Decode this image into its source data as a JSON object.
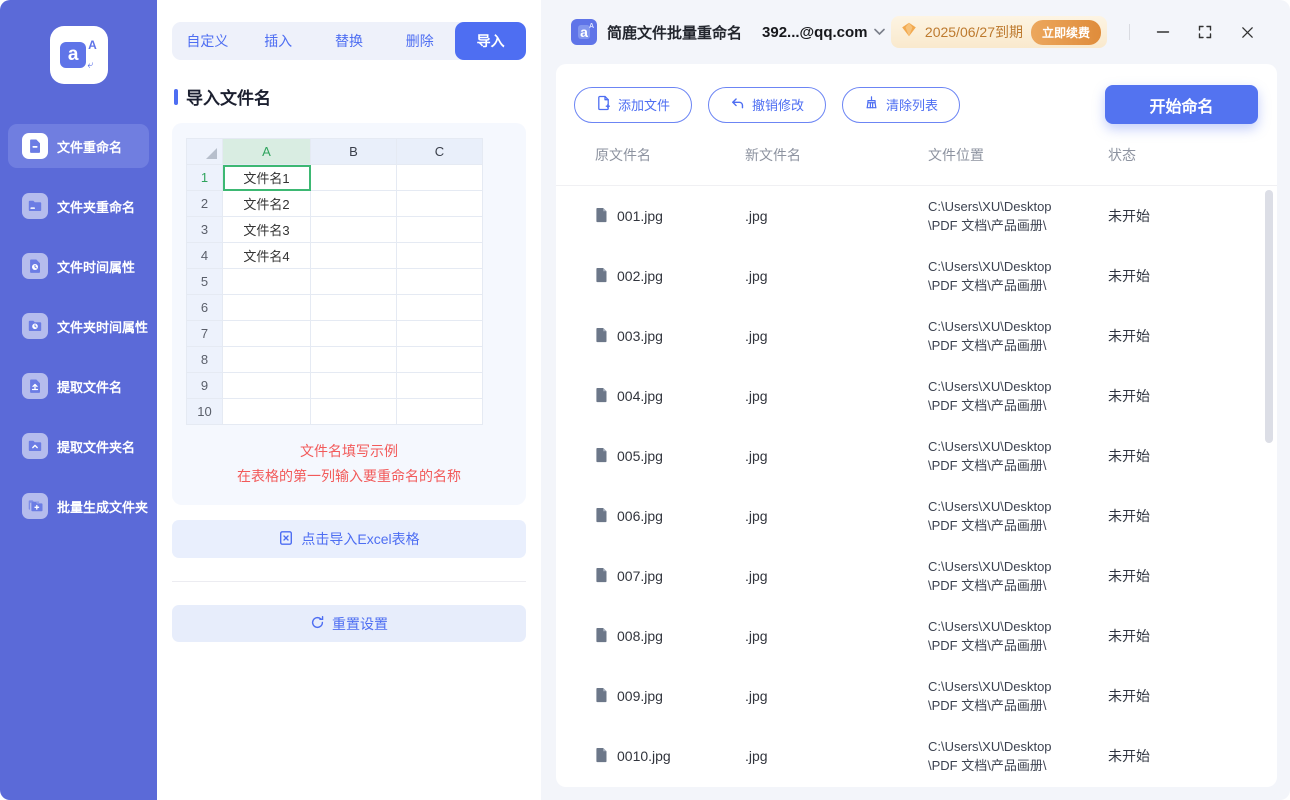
{
  "colors": {
    "sidebar_bg": "#5b6ad8",
    "sidebar_active_bg": "#707ee0",
    "primary_blue": "#4e6ef2",
    "start_button_blue": "#5373f0",
    "panel_bg": "#f3f5fa",
    "hint_red": "#f25a5a",
    "sheet_green": "#2fa45d",
    "selected_cell_border": "#3db873",
    "vip_bg": "#f9e9cd",
    "vip_text": "#bd7a2f",
    "renew_orange": "#df8c3b"
  },
  "sidebar": {
    "logo": {
      "letter_main": "a",
      "letter_small": "A"
    },
    "items": [
      {
        "key": "file-rename",
        "label": "文件重命名",
        "icon": "file-icon",
        "active": true
      },
      {
        "key": "folder-rename",
        "label": "文件夹重命名",
        "icon": "folder-icon",
        "active": false
      },
      {
        "key": "file-time",
        "label": "文件时间属性",
        "icon": "file-clock-icon",
        "active": false
      },
      {
        "key": "folder-time",
        "label": "文件夹时间属性",
        "icon": "folder-clock-icon",
        "active": false
      },
      {
        "key": "extract-filename",
        "label": "提取文件名",
        "icon": "file-export-icon",
        "active": false
      },
      {
        "key": "extract-foldername",
        "label": "提取文件夹名",
        "icon": "folder-export-icon",
        "active": false
      },
      {
        "key": "batch-create-folder",
        "label": "批量生成文件夹",
        "icon": "folder-plus-icon",
        "active": false
      }
    ]
  },
  "middle": {
    "tabs": [
      {
        "key": "custom",
        "label": "自定义",
        "active": false
      },
      {
        "key": "insert",
        "label": "插入",
        "active": false
      },
      {
        "key": "replace",
        "label": "替换",
        "active": false
      },
      {
        "key": "delete",
        "label": "删除",
        "active": false
      },
      {
        "key": "import",
        "label": "导入",
        "active": true
      }
    ],
    "section_title": "导入文件名",
    "spreadsheet": {
      "columns": [
        "A",
        "B",
        "C"
      ],
      "selected_cell": "A1",
      "rows": [
        {
          "n": "1",
          "a": "文件名1"
        },
        {
          "n": "2",
          "a": "文件名2"
        },
        {
          "n": "3",
          "a": "文件名3"
        },
        {
          "n": "4",
          "a": "文件名4"
        },
        {
          "n": "5",
          "a": ""
        },
        {
          "n": "6",
          "a": ""
        },
        {
          "n": "7",
          "a": ""
        },
        {
          "n": "8",
          "a": ""
        },
        {
          "n": "9",
          "a": ""
        },
        {
          "n": "10",
          "a": ""
        }
      ]
    },
    "hint_line1": "文件名填写示例",
    "hint_line2": "在表格的第一列输入要重命名的名称",
    "import_button_label": "点击导入Excel表格",
    "reset_button_label": "重置设置"
  },
  "header": {
    "app_title": "简鹿文件批量重命名",
    "account": "392...@qq.com",
    "vip_expiry": "2025/06/27到期",
    "renew_label": "立即续费"
  },
  "toolbar": {
    "add_files_label": "添加文件",
    "undo_label": "撤销修改",
    "clear_label": "清除列表",
    "start_label": "开始命名"
  },
  "file_table": {
    "headers": [
      "原文件名",
      "新文件名",
      "文件位置",
      "状态"
    ],
    "rows": [
      {
        "original": "001.jpg",
        "new_name": ".jpg",
        "path_line1": "C:\\Users\\XU\\Desktop",
        "path_line2": "\\PDF 文档\\产品画册\\",
        "status": "未开始"
      },
      {
        "original": "002.jpg",
        "new_name": ".jpg",
        "path_line1": "C:\\Users\\XU\\Desktop",
        "path_line2": "\\PDF 文档\\产品画册\\",
        "status": "未开始"
      },
      {
        "original": "003.jpg",
        "new_name": ".jpg",
        "path_line1": "C:\\Users\\XU\\Desktop",
        "path_line2": "\\PDF 文档\\产品画册\\",
        "status": "未开始"
      },
      {
        "original": "004.jpg",
        "new_name": ".jpg",
        "path_line1": "C:\\Users\\XU\\Desktop",
        "path_line2": "\\PDF 文档\\产品画册\\",
        "status": "未开始"
      },
      {
        "original": "005.jpg",
        "new_name": ".jpg",
        "path_line1": "C:\\Users\\XU\\Desktop",
        "path_line2": "\\PDF 文档\\产品画册\\",
        "status": "未开始"
      },
      {
        "original": "006.jpg",
        "new_name": ".jpg",
        "path_line1": "C:\\Users\\XU\\Desktop",
        "path_line2": "\\PDF 文档\\产品画册\\",
        "status": "未开始"
      },
      {
        "original": "007.jpg",
        "new_name": ".jpg",
        "path_line1": "C:\\Users\\XU\\Desktop",
        "path_line2": "\\PDF 文档\\产品画册\\",
        "status": "未开始"
      },
      {
        "original": "008.jpg",
        "new_name": ".jpg",
        "path_line1": "C:\\Users\\XU\\Desktop",
        "path_line2": "\\PDF 文档\\产品画册\\",
        "status": "未开始"
      },
      {
        "original": "009.jpg",
        "new_name": ".jpg",
        "path_line1": "C:\\Users\\XU\\Desktop",
        "path_line2": "\\PDF 文档\\产品画册\\",
        "status": "未开始"
      },
      {
        "original": "0010.jpg",
        "new_name": ".jpg",
        "path_line1": "C:\\Users\\XU\\Desktop",
        "path_line2": "\\PDF 文档\\产品画册\\",
        "status": "未开始"
      }
    ]
  }
}
